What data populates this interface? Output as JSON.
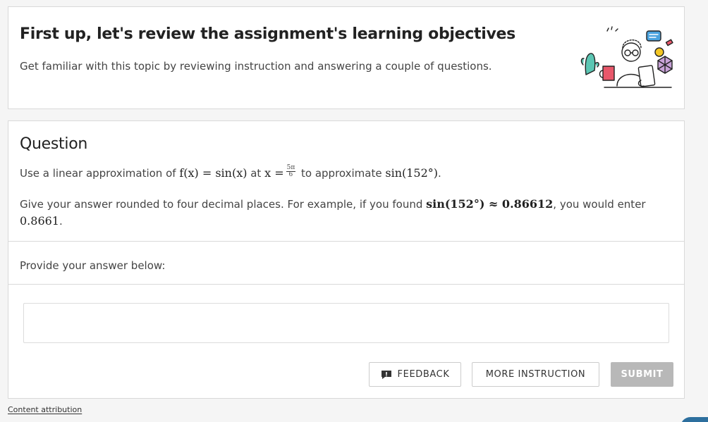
{
  "intro": {
    "title": "First up, let's review the assignment's learning objectives",
    "subtitle": "Get familiar with this topic by reviewing instruction and answering a couple of questions."
  },
  "question": {
    "heading": "Question",
    "line1_prefix": "Use a linear approximation of ",
    "line1_func": "f(x) = sin(x)",
    "line1_at": " at ",
    "line1_x": "x =",
    "line1_frac_num": "5π",
    "line1_frac_den": "6",
    "line1_mid": " to approximate ",
    "line1_target": "sin(152°)",
    "line1_end": ".",
    "line2_prefix": "Give your answer rounded to four decimal places. For example, if you found ",
    "line2_example": "sin(152°) ≈ 0.86612",
    "line2_suffix": ", you would enter",
    "line3_value": "0.8661",
    "line3_end": "."
  },
  "answer": {
    "prompt": "Provide your answer below:",
    "value": "",
    "placeholder": ""
  },
  "buttons": {
    "feedback": "FEEDBACK",
    "more_instruction": "MORE INSTRUCTION",
    "submit": "SUBMIT"
  },
  "footer": {
    "attribution": "Content attribution"
  },
  "icons": {
    "feedback": "feedback-speech-icon",
    "illustration": "student-study-illustration"
  },
  "colors": {
    "submit_disabled": "#b8b8b8",
    "accent_tab": "#2d6f9e"
  }
}
